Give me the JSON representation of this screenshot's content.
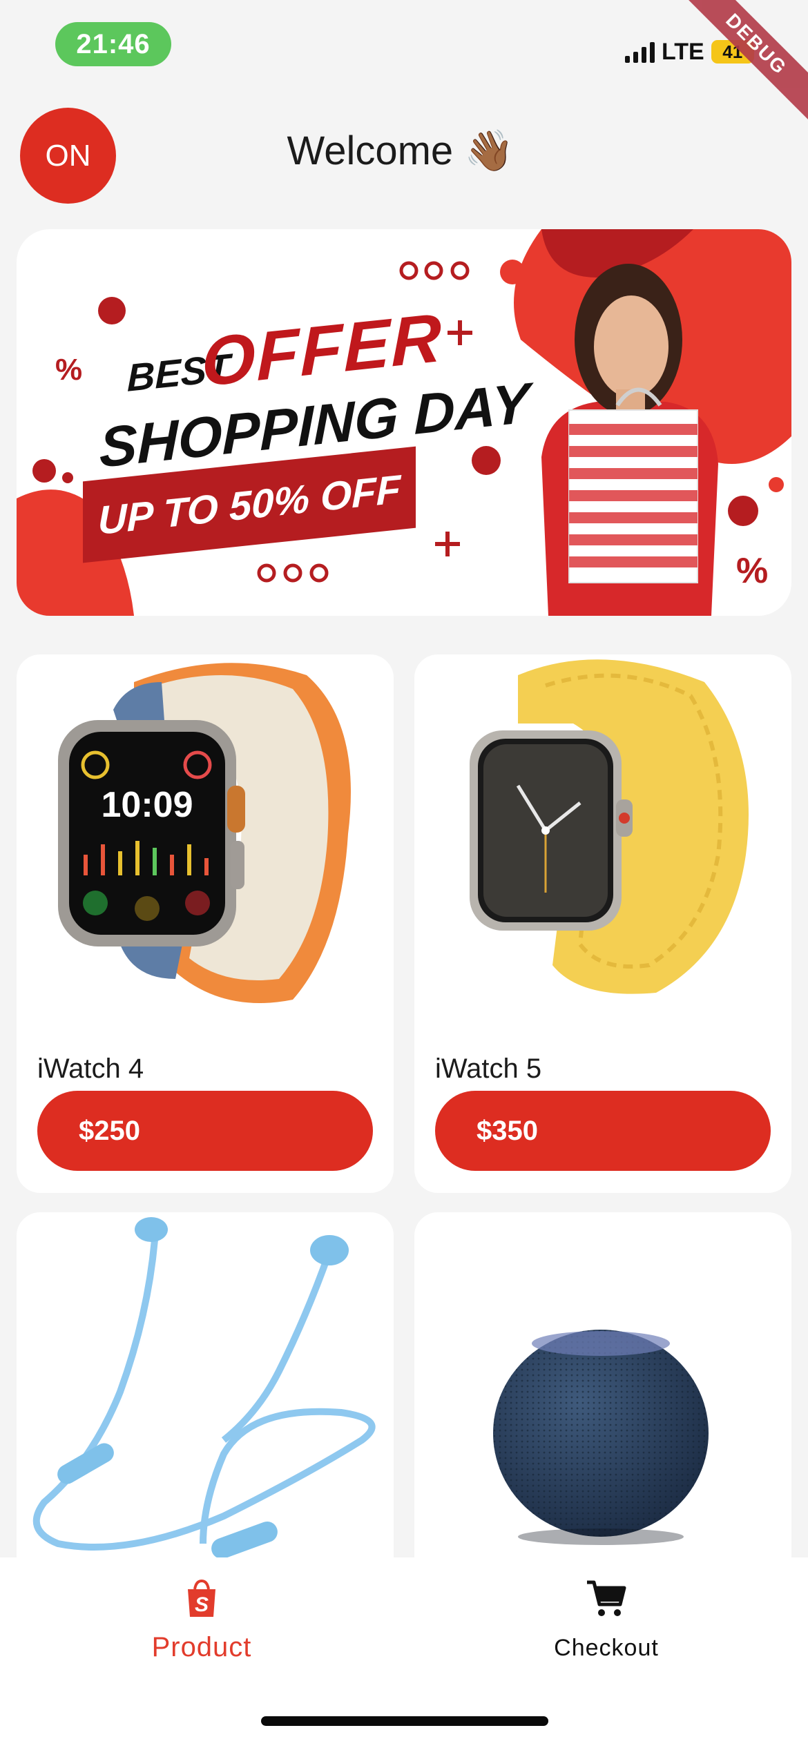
{
  "status_bar": {
    "time": "21:46",
    "network": "LTE",
    "battery": "41",
    "debug_label": "DEBUG"
  },
  "header": {
    "avatar_initials": "ON",
    "title": "Welcome 👋🏾"
  },
  "banner": {
    "best": "BEST",
    "offer": "OFFER",
    "headline": "SHOPPING DAY",
    "discount": "UP TO 50% OFF",
    "accent_color": "#e83a2e",
    "dark_red": "#b51d20"
  },
  "products": [
    {
      "name": "iWatch 4",
      "price": "$250",
      "image": "apple-watch-ultra-orange-band"
    },
    {
      "name": "iWatch 5",
      "price": "$350",
      "image": "apple-watch-yellow-braided-band"
    },
    {
      "name": "",
      "price": "",
      "image": "blue-wireless-earphones"
    },
    {
      "name": "",
      "price": "",
      "image": "navy-homepod-mini"
    }
  ],
  "bottom_nav": {
    "items": [
      {
        "label": "Product",
        "icon": "shopping-bag-icon",
        "active": true
      },
      {
        "label": "Checkout",
        "icon": "cart-icon",
        "active": false
      }
    ]
  },
  "colors": {
    "primary": "#dd2d21",
    "background": "#f4f4f4",
    "status_pill": "#5cc75c"
  }
}
